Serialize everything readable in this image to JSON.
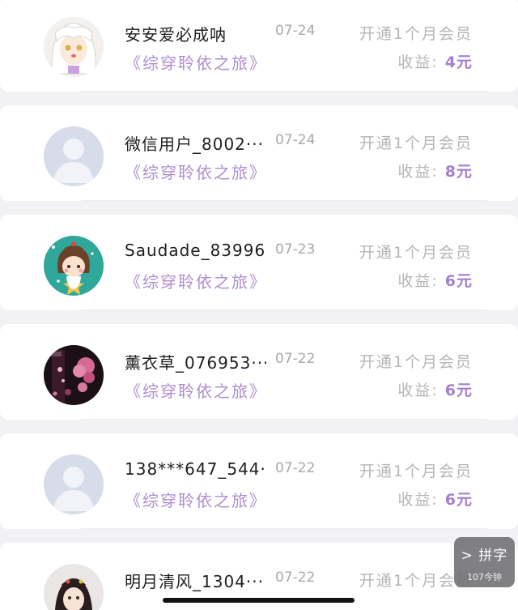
{
  "records": [
    {
      "name": "安安爱必成呐",
      "date": "07-24",
      "action": "开通1个月会员",
      "book": "《综穿聆依之旅》",
      "income_label": "收益:",
      "income_amount": "4元",
      "avatar": "anime-girl"
    },
    {
      "name": "微信用户_8002···",
      "date": "07-24",
      "action": "开通1个月会员",
      "book": "《综穿聆依之旅》",
      "income_label": "收益:",
      "income_amount": "8元",
      "avatar": "default-user"
    },
    {
      "name": "Saudade_83996···",
      "date": "07-23",
      "action": "开通1个月会员",
      "book": "《综穿聆依之旅》",
      "income_label": "收益:",
      "income_amount": "6元",
      "avatar": "cartoon-girl-star"
    },
    {
      "name": "薰衣草_076953···",
      "date": "07-22",
      "action": "开通1个月会员",
      "book": "《综穿聆依之旅》",
      "income_label": "收益:",
      "income_amount": "6元",
      "avatar": "dark-floral"
    },
    {
      "name": "138***647_544···",
      "date": "07-22",
      "action": "开通1个月会员",
      "book": "《综穿聆依之旅》",
      "income_label": "收益:",
      "income_amount": "6元",
      "avatar": "default-user"
    },
    {
      "name": "明月清风_1304···",
      "date": "07-22",
      "action": "开通1个月会员",
      "book": "",
      "income_label": "",
      "income_amount": "",
      "avatar": "anime-portrait"
    }
  ],
  "ime": {
    "top": "> 拼字",
    "bottom": "107今钟"
  },
  "colors": {
    "accent": "#a57fcc",
    "book": "#b08dd0",
    "muted": "#b5b5b5"
  }
}
